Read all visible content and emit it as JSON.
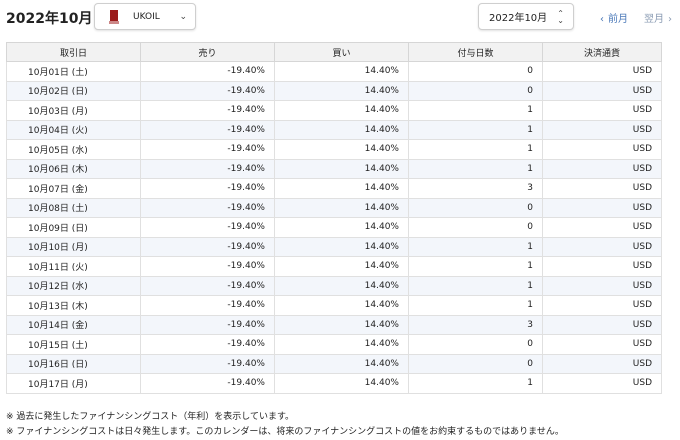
{
  "header": {
    "title": "2022年10月",
    "instrument": {
      "name": "UKOIL",
      "icon": "brand-logo-icon"
    },
    "month_select": "2022年10月",
    "prev_label": "前月",
    "next_label": "翌月"
  },
  "table": {
    "columns": [
      "取引日",
      "売り",
      "買い",
      "付与日数",
      "決済通貨"
    ],
    "rows": [
      [
        "10月01日 (土)",
        "-19.40%",
        "14.40%",
        "0",
        "USD"
      ],
      [
        "10月02日 (日)",
        "-19.40%",
        "14.40%",
        "0",
        "USD"
      ],
      [
        "10月03日 (月)",
        "-19.40%",
        "14.40%",
        "1",
        "USD"
      ],
      [
        "10月04日 (火)",
        "-19.40%",
        "14.40%",
        "1",
        "USD"
      ],
      [
        "10月05日 (水)",
        "-19.40%",
        "14.40%",
        "1",
        "USD"
      ],
      [
        "10月06日 (木)",
        "-19.40%",
        "14.40%",
        "1",
        "USD"
      ],
      [
        "10月07日 (金)",
        "-19.40%",
        "14.40%",
        "3",
        "USD"
      ],
      [
        "10月08日 (土)",
        "-19.40%",
        "14.40%",
        "0",
        "USD"
      ],
      [
        "10月09日 (日)",
        "-19.40%",
        "14.40%",
        "0",
        "USD"
      ],
      [
        "10月10日 (月)",
        "-19.40%",
        "14.40%",
        "1",
        "USD"
      ],
      [
        "10月11日 (火)",
        "-19.40%",
        "14.40%",
        "1",
        "USD"
      ],
      [
        "10月12日 (水)",
        "-19.40%",
        "14.40%",
        "1",
        "USD"
      ],
      [
        "10月13日 (木)",
        "-19.40%",
        "14.40%",
        "1",
        "USD"
      ],
      [
        "10月14日 (金)",
        "-19.40%",
        "14.40%",
        "3",
        "USD"
      ],
      [
        "10月15日 (土)",
        "-19.40%",
        "14.40%",
        "0",
        "USD"
      ],
      [
        "10月16日 (日)",
        "-19.40%",
        "14.40%",
        "0",
        "USD"
      ],
      [
        "10月17日 (月)",
        "-19.40%",
        "14.40%",
        "1",
        "USD"
      ]
    ]
  },
  "notes": [
    "※ 過去に発生したファイナンシングコスト（年利）を表示しています。",
    "※ ファイナンシングコストは日々発生します。このカレンダーは、将来のファイナンシングコストの値をお約束するものではありません。"
  ],
  "colors": {
    "accent": "#4a78b8",
    "row_alt": "#f3f6fb",
    "header_bg": "#f2f2f2",
    "logo": "#9b1c1c"
  }
}
